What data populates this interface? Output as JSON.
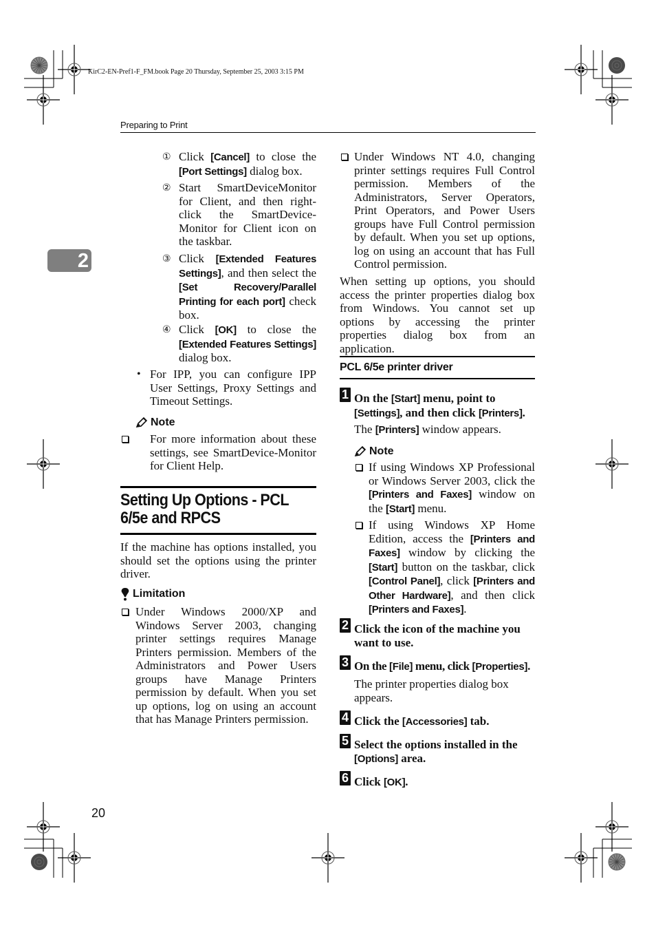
{
  "book_header": "KirC2-EN-Pref1-F_FM.book  Page 20  Thursday, September 25, 2003  3:15 PM",
  "running_head": "Preparing to Print",
  "chapter_tab": "2",
  "page_number": "20",
  "left_column": {
    "substeps": [
      {
        "marker": "①",
        "parts": [
          [
            "t",
            "Click "
          ],
          [
            "b",
            "[Cancel]"
          ],
          [
            "t",
            " to close the "
          ],
          [
            "b",
            "[Port Settings]"
          ],
          [
            "t",
            " dialog box."
          ]
        ]
      },
      {
        "marker": "②",
        "parts": [
          [
            "t",
            "Start SmartDeviceMonitor for Client, and then right-click the SmartDevice-Monitor for Client icon on the taskbar."
          ]
        ]
      },
      {
        "marker": "③",
        "parts": [
          [
            "t",
            "Click "
          ],
          [
            "b",
            "[Extended Features Settings]"
          ],
          [
            "t",
            ", and then select the "
          ],
          [
            "b",
            "[Set Recovery/Parallel Printing for each port]"
          ],
          [
            "t",
            " check box."
          ]
        ]
      },
      {
        "marker": "④",
        "parts": [
          [
            "t",
            "Click "
          ],
          [
            "b",
            "[OK]"
          ],
          [
            "t",
            " to close the "
          ],
          [
            "b",
            "[Extended Features Settings]"
          ],
          [
            "t",
            " dialog box."
          ]
        ]
      }
    ],
    "bullet": "For IPP, you can configure IPP User Settings, Proxy Settings and Timeout Settings.",
    "note_heading": "Note",
    "note_items": [
      "For more information about these settings, see SmartDevice-Monitor for Client Help."
    ],
    "section_title": "Setting Up Options - PCL 6/5e and RPCS",
    "intro": "If the machine has options installed, you should set the options using the printer driver.",
    "limitation_heading": "Limitation",
    "limitation_items": [
      "Under Windows 2000/XP and Windows Server 2003, changing printer settings requires Manage Printers permission. Members of the Administrators and Power Users groups have Manage Printers permission by default. When you set up options, log on using an account that has Manage Printers permission."
    ]
  },
  "right_column": {
    "limitation_items": [
      "Under Windows NT 4.0, changing printer settings requires Full Control permission. Members of the Administrators, Server Operators, Print Operators, and Power Users groups have Full Control permission by default. When you set up options, log on using an account that has Full Control permission."
    ],
    "paragraph": "When setting up options, you should access the printer properties dialog box from Windows. You cannot set up options by accessing the printer properties dialog box from an application.",
    "subsection_title": "PCL 6/5e printer driver",
    "steps": [
      {
        "num": "1",
        "parts": [
          [
            "t",
            "On the "
          ],
          [
            "b",
            "[Start]"
          ],
          [
            "t",
            " menu, point to "
          ],
          [
            "b",
            "[Settings]"
          ],
          [
            "t",
            ", and then click "
          ],
          [
            "b",
            "[Printers]"
          ],
          [
            "t",
            "."
          ]
        ],
        "result": [
          [
            "t",
            "The "
          ],
          [
            "b",
            "[Printers]"
          ],
          [
            "t",
            " window appears."
          ]
        ]
      },
      {
        "num": "2",
        "parts": [
          [
            "t",
            "Click the icon of the machine you want to use."
          ]
        ]
      },
      {
        "num": "3",
        "parts": [
          [
            "t",
            "On the "
          ],
          [
            "b",
            "[File]"
          ],
          [
            "t",
            " menu, click "
          ],
          [
            "b",
            "[Properties]"
          ],
          [
            "t",
            "."
          ]
        ],
        "result": [
          [
            "t",
            "The printer properties dialog box appears."
          ]
        ]
      },
      {
        "num": "4",
        "parts": [
          [
            "t",
            "Click the "
          ],
          [
            "b",
            "[Accessories]"
          ],
          [
            "t",
            " tab."
          ]
        ]
      },
      {
        "num": "5",
        "parts": [
          [
            "t",
            "Select the options installed in the "
          ],
          [
            "b",
            "[Options]"
          ],
          [
            "t",
            " area."
          ]
        ]
      },
      {
        "num": "6",
        "parts": [
          [
            "t",
            "Click "
          ],
          [
            "b",
            "[OK]"
          ],
          [
            "t",
            "."
          ]
        ]
      }
    ],
    "note_heading": "Note",
    "note_items": [
      [
        [
          "t",
          "If using Windows XP Professional or Windows Server 2003, click the "
        ],
        [
          "b",
          "[Printers and Faxes]"
        ],
        [
          "t",
          " window on the "
        ],
        [
          "b",
          "[Start]"
        ],
        [
          "t",
          " menu."
        ]
      ],
      [
        [
          "t",
          "If using Windows XP Home Edition, access the "
        ],
        [
          "b",
          "[Printers and Faxes]"
        ],
        [
          "t",
          " window by clicking the "
        ],
        [
          "b",
          "[Start]"
        ],
        [
          "t",
          " button on the taskbar, click "
        ],
        [
          "b",
          "[Control Panel]"
        ],
        [
          "t",
          ", click "
        ],
        [
          "b",
          "[Printers and Other Hardware]"
        ],
        [
          "t",
          ", and then click "
        ],
        [
          "b",
          "[Printers and Faxes]"
        ],
        [
          "t",
          "."
        ]
      ]
    ]
  },
  "icons": {
    "note": "pencil-icon",
    "limitation": "limitation-icon",
    "registration_marks": "crosshair-registration-icon",
    "color_targets": "starburst-target-icon"
  }
}
